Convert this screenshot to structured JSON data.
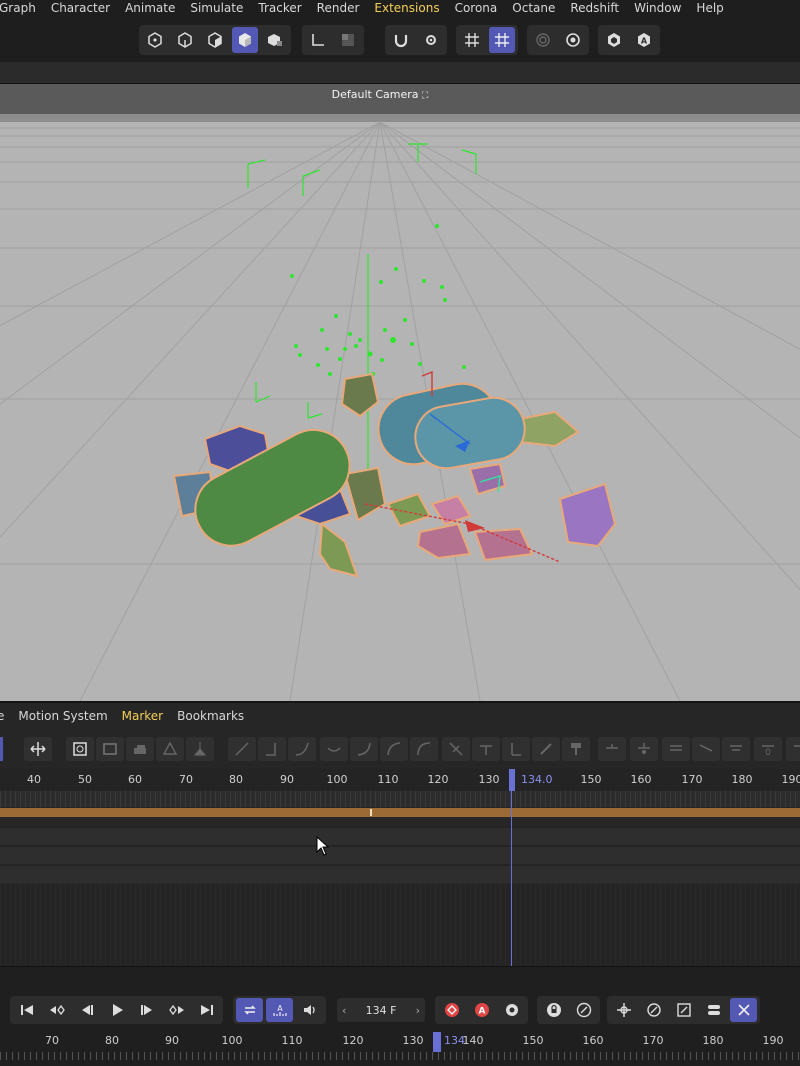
{
  "menu": {
    "items": [
      "Graph",
      "Character",
      "Animate",
      "Simulate",
      "Tracker",
      "Render",
      "Extensions",
      "Corona",
      "Octane",
      "Redshift",
      "Window",
      "Help"
    ],
    "active": "Extensions"
  },
  "toolbar": {
    "groups": [
      [
        "points-mode-icon",
        "edges-mode-icon",
        "polygons-mode-icon",
        "model-mode-icon",
        "object-axis-icon"
      ],
      [
        "axis-mode-icon",
        "texture-mode-icon"
      ],
      [
        "snap-magnet-icon",
        "snap-settings-icon"
      ],
      [
        "grid-snap-icon",
        "workplane-snap-icon"
      ],
      [
        "solo-ring-icon",
        "solo-gear-icon"
      ],
      [
        "redshift-logo-icon",
        "arnold-logo-icon"
      ]
    ],
    "selected": [
      "model-mode-icon",
      "workplane-snap-icon"
    ]
  },
  "viewport": {
    "camera_label": "Default Camera",
    "camera_label_icon": "camera-lock-icon",
    "background_color": "#b5b5b5"
  },
  "timeline": {
    "menu_items": [
      "e",
      "Motion System",
      "Marker",
      "Bookmarks"
    ],
    "active_menu": "Marker",
    "ruler_ticks": [
      "40",
      "50",
      "60",
      "70",
      "80",
      "90",
      "100",
      "110",
      "120",
      "130",
      "150",
      "160",
      "170",
      "180",
      "190"
    ],
    "current_frame": "134",
    "current_frame_suffix": ".0",
    "accent_color": "#6a6fd6",
    "key_track_color": "#9b6a35"
  },
  "playback": {
    "frame_value": "134 F",
    "frame_prev": "‹",
    "frame_next": "›",
    "bottom_ruler_ticks": [
      "70",
      "80",
      "90",
      "100",
      "110",
      "120",
      "130",
      "140",
      "150",
      "160",
      "170",
      "180",
      "190"
    ],
    "bottom_current": "134"
  }
}
